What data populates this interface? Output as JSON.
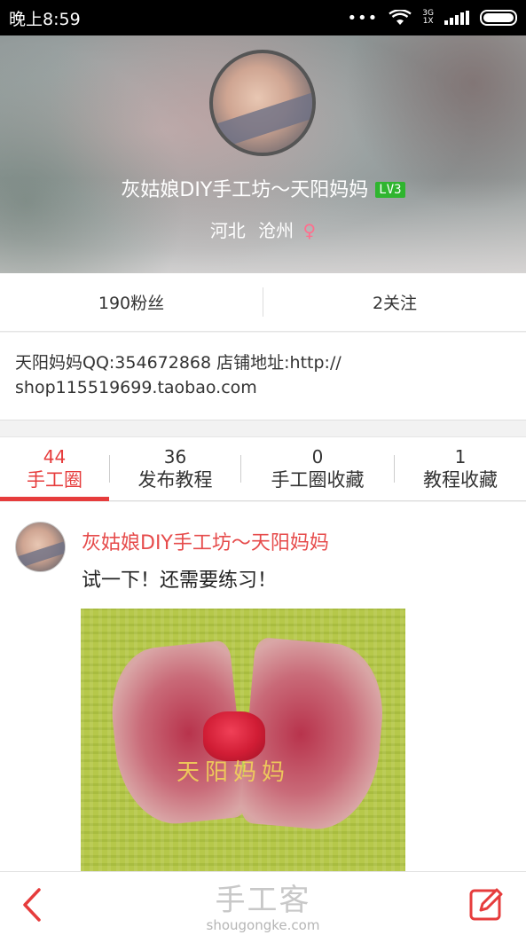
{
  "status_bar": {
    "time": "晚上8:59",
    "dots": "•••",
    "network_top": "3G",
    "network_bottom": "1X",
    "icons": [
      "wifi-icon",
      "signal-icon",
      "battery-icon"
    ]
  },
  "profile": {
    "name": "灰姑娘DIY手工坊～天阳妈妈",
    "level": "LV3",
    "province": "河北",
    "city": "沧州",
    "gender_symbol": "♀"
  },
  "stats": {
    "fans": "190粉丝",
    "following": "2关注"
  },
  "bio": {
    "line1": "天阳妈妈QQ:354672868 店铺地址:http://",
    "line2": "shop115519699.taobao.com"
  },
  "tabs": [
    {
      "count": "44",
      "label": "手工圈",
      "active": true
    },
    {
      "count": "36",
      "label": "发布教程",
      "active": false
    },
    {
      "count": "0",
      "label": "手工圈收藏",
      "active": false
    },
    {
      "count": "1",
      "label": "教程收藏",
      "active": false
    }
  ],
  "post": {
    "author": "灰姑娘DIY手工坊～天阳妈妈",
    "text": "试一下！还需要练习！",
    "image_watermark": "天阳妈妈"
  },
  "bottom_bar": {
    "logo_cn": "手工客",
    "logo_en": "shougongke.com",
    "icons": [
      "back-arrow-icon",
      "edit-icon"
    ]
  },
  "colors": {
    "accent": "#e63c3c",
    "level_badge": "#2fb52f",
    "gender": "#ff6f8e"
  }
}
